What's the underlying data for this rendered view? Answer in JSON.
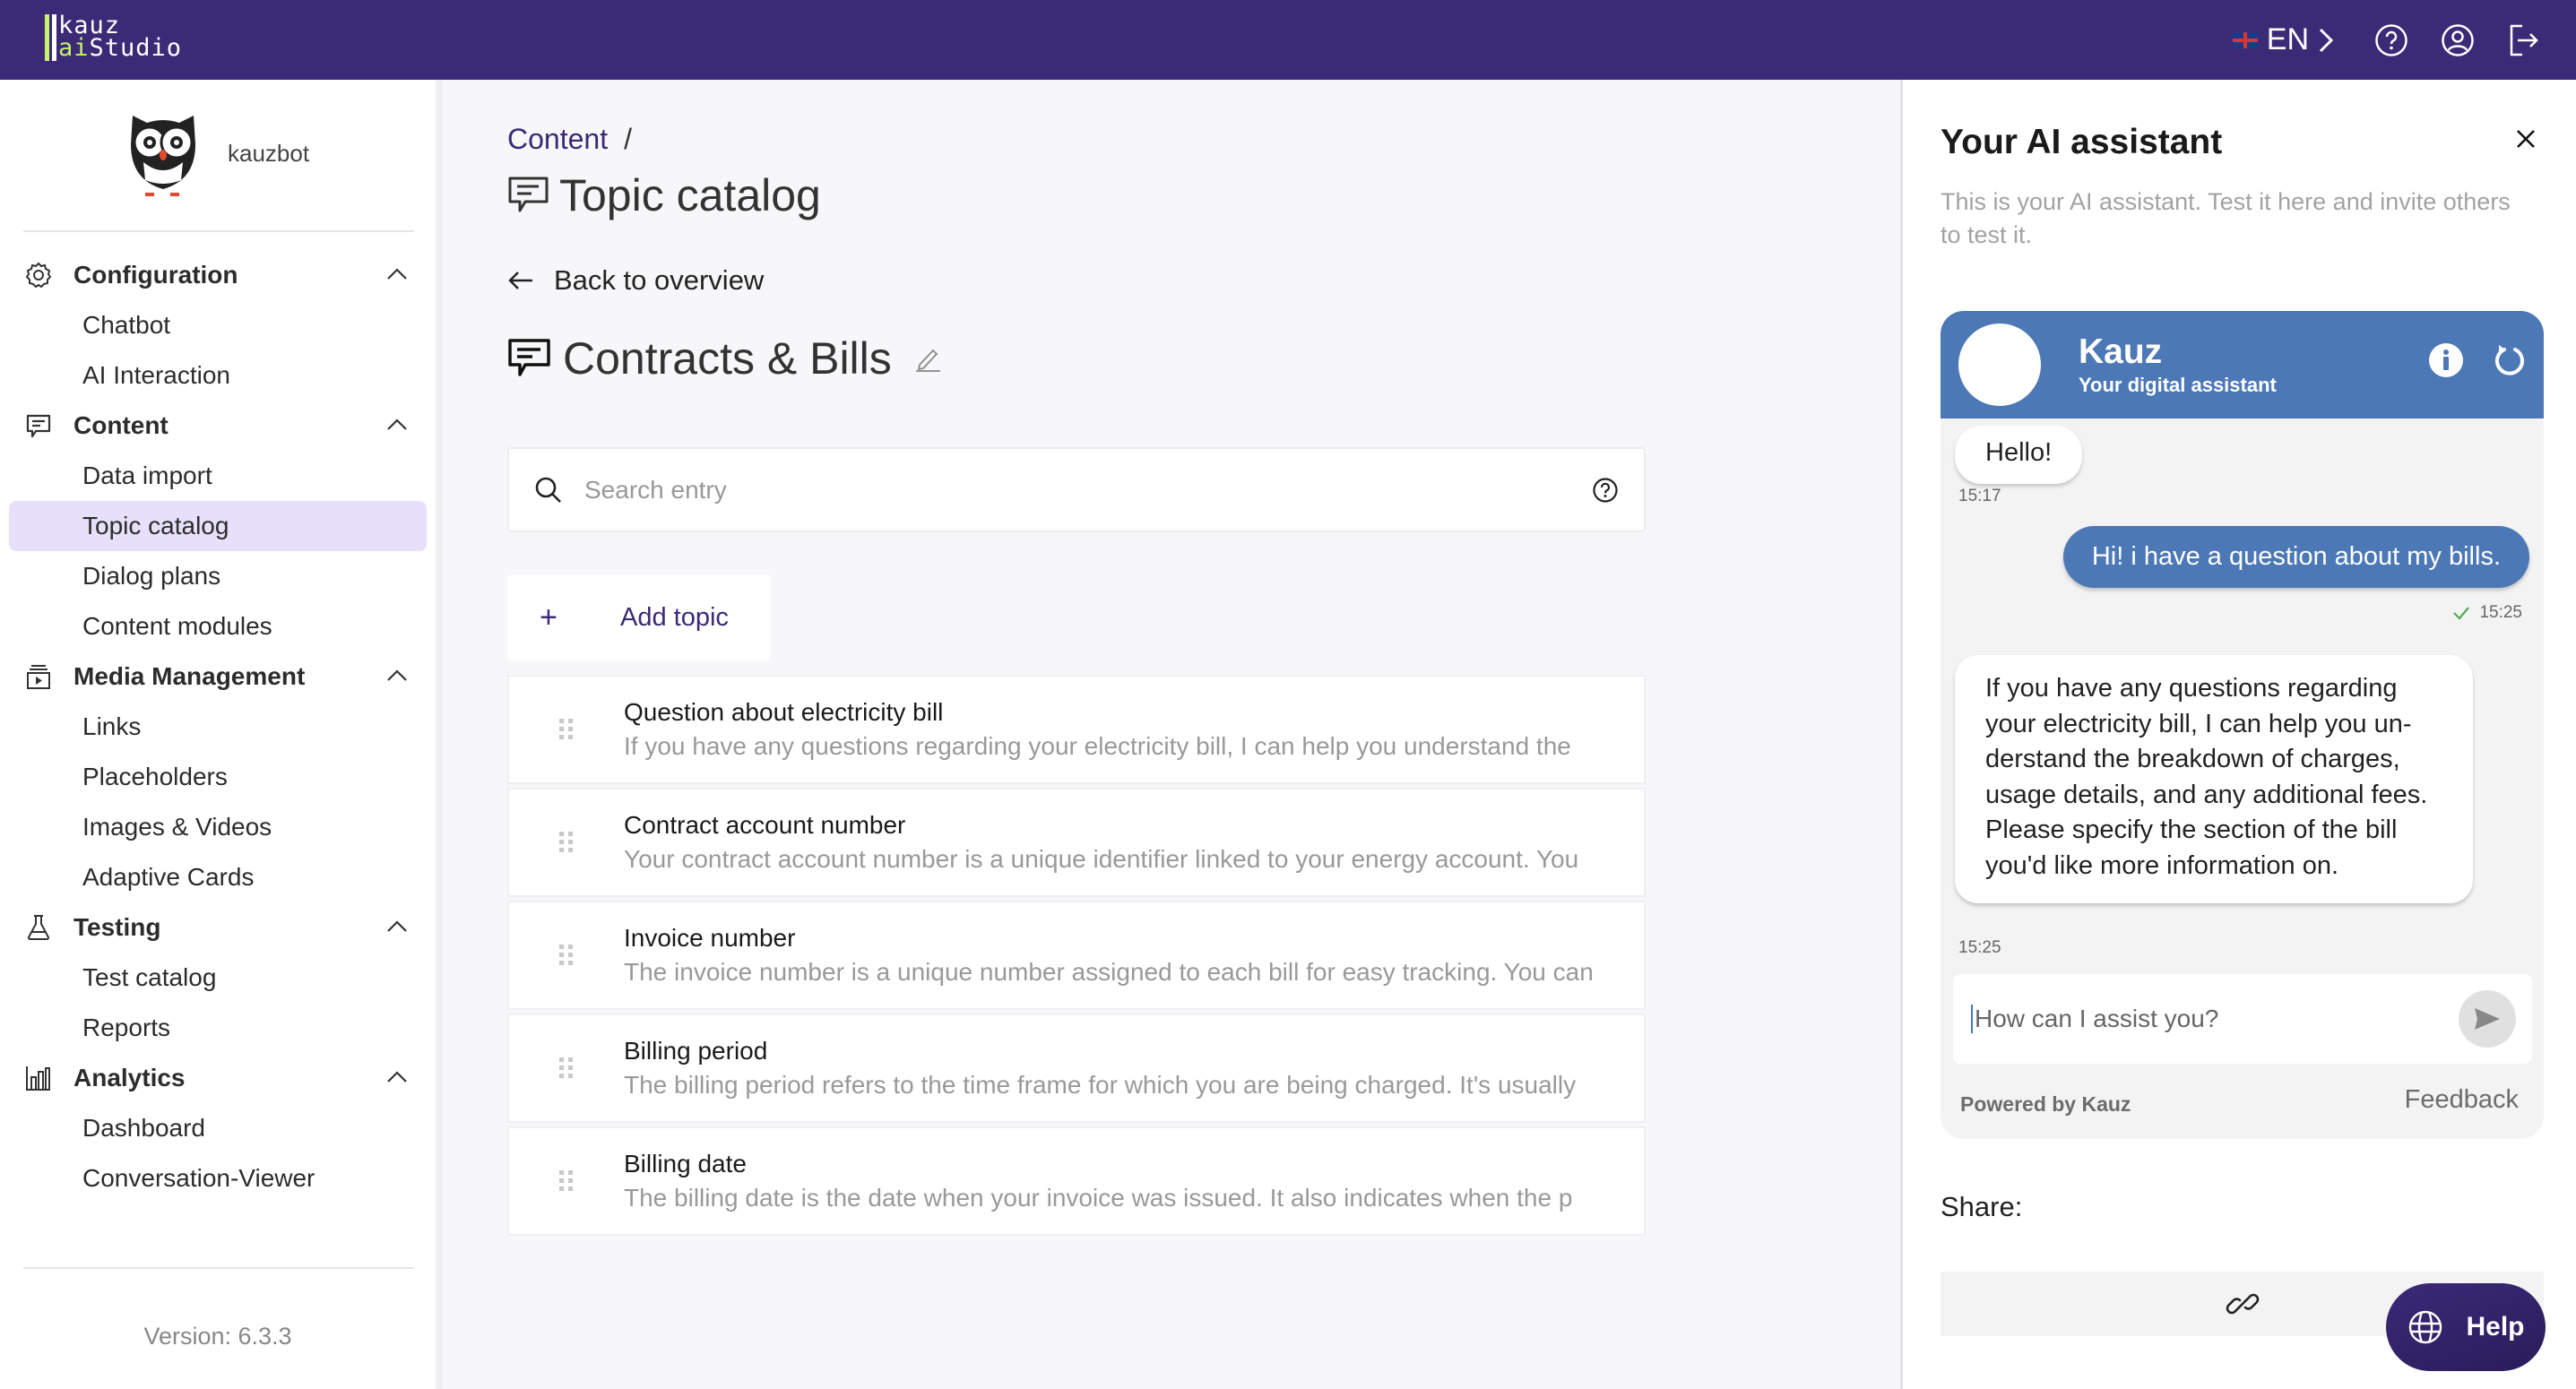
{
  "app": {
    "logo_line1": "kauz",
    "logo_line2_accent": "ai",
    "logo_line2": "Studio",
    "colors": {
      "header_bg": "#3b2a76",
      "accent_green": "#c8f26a",
      "chat_blue": "#4c78b6",
      "active_nav": "#e7e0fb"
    }
  },
  "header": {
    "language": "EN",
    "flag_icon": "uk-flag-icon",
    "icons": [
      "help-circle-icon",
      "user-account-icon",
      "logout-icon"
    ]
  },
  "sidebar": {
    "bot_name": "kauzbot",
    "groups": [
      {
        "label": "Configuration",
        "icon": "gear-icon",
        "items": [
          "Chatbot",
          "AI Interaction"
        ]
      },
      {
        "label": "Content",
        "icon": "chat-icon",
        "items": [
          "Data import",
          "Topic catalog",
          "Dialog plans",
          "Content modules"
        ]
      },
      {
        "label": "Media Management",
        "icon": "media-icon",
        "items": [
          "Links",
          "Placeholders",
          "Images & Videos",
          "Adaptive Cards"
        ]
      },
      {
        "label": "Testing",
        "icon": "flask-icon",
        "items": [
          "Test catalog",
          "Reports"
        ]
      },
      {
        "label": "Analytics",
        "icon": "bar-chart-icon",
        "items": [
          "Dashboard",
          "Conversation-Viewer"
        ]
      }
    ],
    "active_item": "Topic catalog",
    "version": "Version: 6.3.3"
  },
  "main": {
    "breadcrumb": {
      "parent": "Content",
      "separator": "/"
    },
    "page_title": "Topic catalog",
    "back_label": "Back to overview",
    "topic_group_title": "Contracts & Bills",
    "search": {
      "placeholder": "Search entry",
      "value": ""
    },
    "add_topic_label": "Add topic",
    "add_topic_symbol": "+",
    "topics": [
      {
        "title": "Question about electricity bill",
        "description": "If you have any questions regarding your electricity bill, I can help you understand the"
      },
      {
        "title": "Contract account number",
        "description": "Your contract account number is a unique identifier linked to your energy account. You"
      },
      {
        "title": "Invoice number",
        "description": "The invoice number is a unique number assigned to each bill for easy tracking. You can"
      },
      {
        "title": "Billing period",
        "description": "The billing period refers to the time frame for which you are being charged. It's usually"
      },
      {
        "title": "Billing date",
        "description": "The billing date is the date when your invoice was issued. It also indicates when the p"
      }
    ]
  },
  "assistant": {
    "title": "Your AI assistant",
    "subtitle": "This is your AI assistant. Test it here and invite others to test it.",
    "chat": {
      "bot_name": "Kauz",
      "bot_tagline": "Your digital assistant",
      "messages": [
        {
          "from": "bot",
          "text": "Hello!",
          "time": "15:17"
        },
        {
          "from": "user",
          "text": "Hi! i have a question about my bills.",
          "time": "15:25",
          "status": "delivered"
        },
        {
          "from": "bot",
          "text": "If you have any questions regarding your electricity bill, I can help you un­derstand the breakdown of charges, usage details, and any additional fees. Please specify the section of the bill you'd like more information on.",
          "time": "15:25"
        }
      ],
      "input_placeholder": "How can I assist you?",
      "input_value": "",
      "powered_by": "Powered by Kauz",
      "feedback_label": "Feedback"
    },
    "share_label": "Share:"
  },
  "help_button": {
    "label": "Help"
  }
}
